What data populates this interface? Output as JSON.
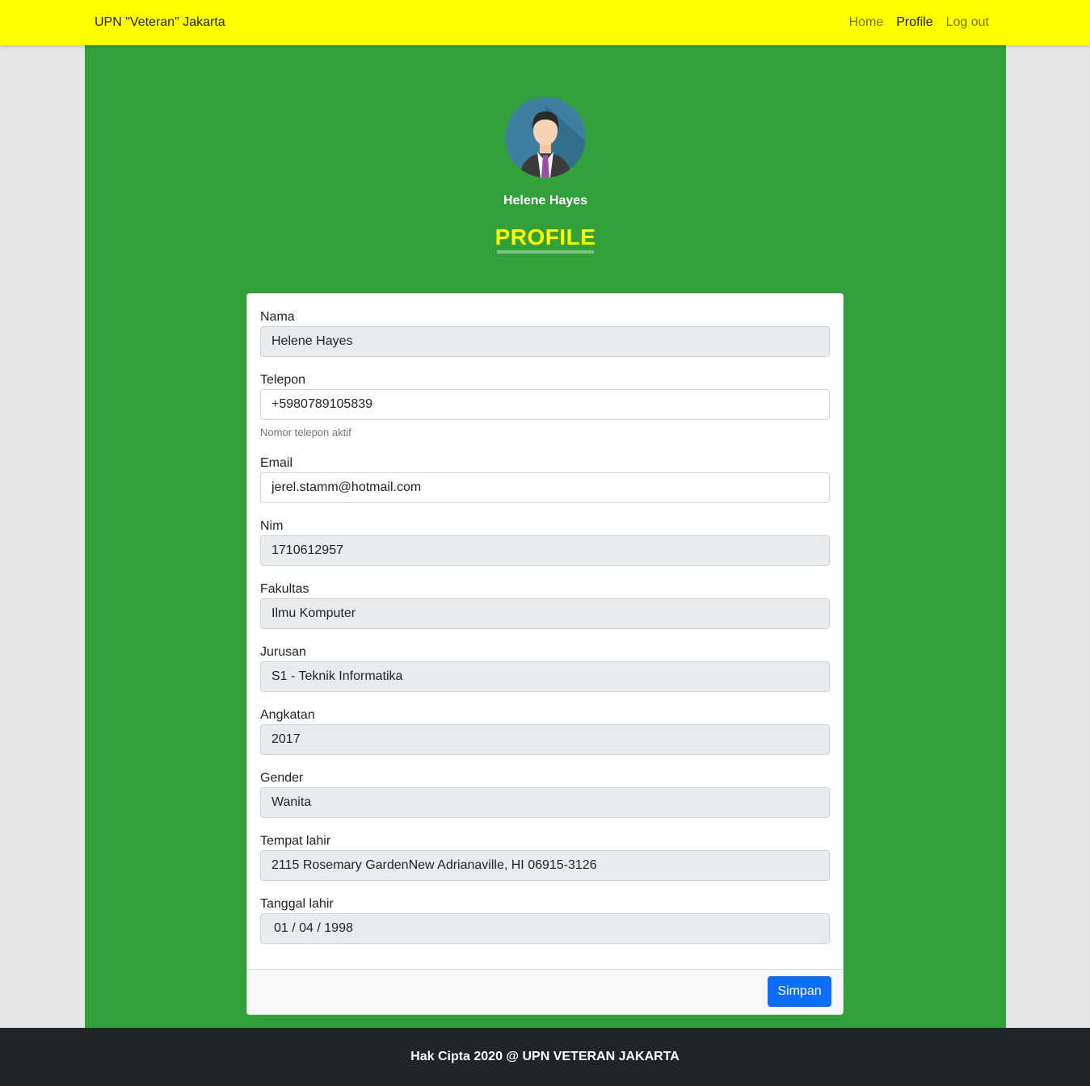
{
  "navbar": {
    "brand": "UPN \"Veteran\" Jakarta",
    "links": [
      {
        "label": "Home",
        "active": false
      },
      {
        "label": "Profile",
        "active": true
      },
      {
        "label": "Log out",
        "active": false
      }
    ]
  },
  "profile": {
    "avatar_icon": "user-avatar-icon",
    "name": "Helene Hayes",
    "heading": "PROFILE"
  },
  "form": {
    "nama": {
      "label": "Nama",
      "value": "Helene Hayes"
    },
    "telepon": {
      "label": "Telepon",
      "value": "+5980789105839",
      "help": "Nomor telepon aktif"
    },
    "email": {
      "label": "Email",
      "value": "jerel.stamm@hotmail.com"
    },
    "nim": {
      "label": "Nim",
      "value": "1710612957"
    },
    "fakultas": {
      "label": "Fakultas",
      "value": "Ilmu Komputer"
    },
    "jurusan": {
      "label": "Jurusan",
      "value": "S1 - Teknik Informatika"
    },
    "angkatan": {
      "label": "Angkatan",
      "value": "2017"
    },
    "gender": {
      "label": "Gender",
      "value": "Wanita"
    },
    "tempat_lahir": {
      "label": "Tempat lahir",
      "value": "2115 Rosemary GardenNew Adrianaville, HI 06915-3126"
    },
    "tanggal_lahir": {
      "label": "Tanggal lahir",
      "value": "01 / 04 / 1998"
    },
    "submit_label": "Simpan"
  },
  "footer": {
    "text": "Hak Cipta 2020 @ UPN VETERAN JAKARTA"
  },
  "colors": {
    "navbar": "#ffff00",
    "main": "#33a13b",
    "heading": "#ffff00",
    "button": "#0d6efd",
    "footer": "#212529"
  }
}
